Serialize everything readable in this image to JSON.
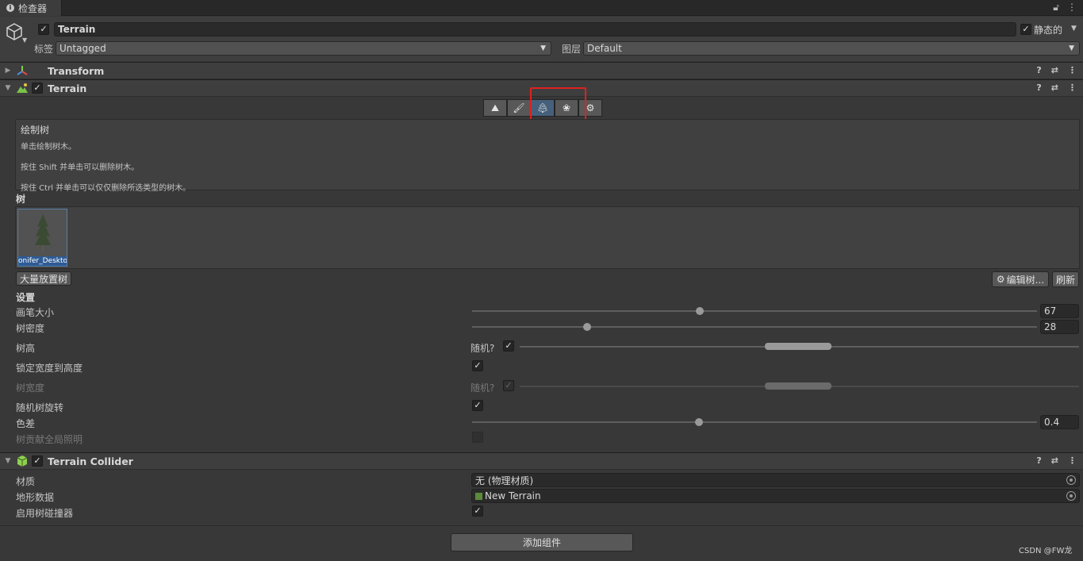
{
  "tab": {
    "title": "检查器"
  },
  "object": {
    "name": "Terrain",
    "static_label": "静态的",
    "tag_label": "标签",
    "tag_value": "Untagged",
    "layer_label": "图层",
    "layer_value": "Default"
  },
  "components": {
    "transform": {
      "name": "Transform"
    },
    "terrain": {
      "name": "Terrain"
    },
    "collider": {
      "name": "Terrain Collider"
    }
  },
  "toolbar": {
    "buttons": [
      "raise-lower-icon",
      "paint-texture-icon",
      "paint-trees-icon",
      "paint-details-icon",
      "terrain-settings-icon"
    ],
    "selected_index": 2,
    "highlight_color": "#e02020"
  },
  "help": {
    "title": "绘制树",
    "line1": "单击绘制树木。",
    "line2": "按住 Shift 并单击可以删除树木。",
    "line3": "按住 Ctrl 并单击可以仅仅删除所选类型的树木。"
  },
  "trees": {
    "header": "树",
    "items": [
      {
        "label": "onifer_Deskto"
      }
    ],
    "mass_place": "大量放置树",
    "edit_trees": "编辑树...",
    "refresh": "刷新"
  },
  "settings": {
    "header": "设置",
    "brush_size": {
      "label": "画笔大小",
      "value": "67",
      "fraction": 0.4
    },
    "tree_density": {
      "label": "树密度",
      "value": "28",
      "fraction": 0.2
    },
    "tree_height": {
      "label": "树高",
      "random_label": "随机?"
    },
    "lock_width": {
      "label": "锁定宽度到高度"
    },
    "tree_width": {
      "label": "树宽度",
      "random_label": "随机?"
    },
    "random_rotation": {
      "label": "随机树旋转"
    },
    "color_variation": {
      "label": "色差",
      "value": "0.4",
      "fraction": 0.4
    },
    "contribute_gi": {
      "label": "树贡献全局照明"
    }
  },
  "collider": {
    "material_label": "材质",
    "material_value": "无 (物理材质)",
    "terrain_data_label": "地形数据",
    "terrain_data_value": "New Terrain",
    "tree_colliders_label": "启用树碰撞器"
  },
  "add_component": "添加组件",
  "watermark": "CSDN @FW龙"
}
